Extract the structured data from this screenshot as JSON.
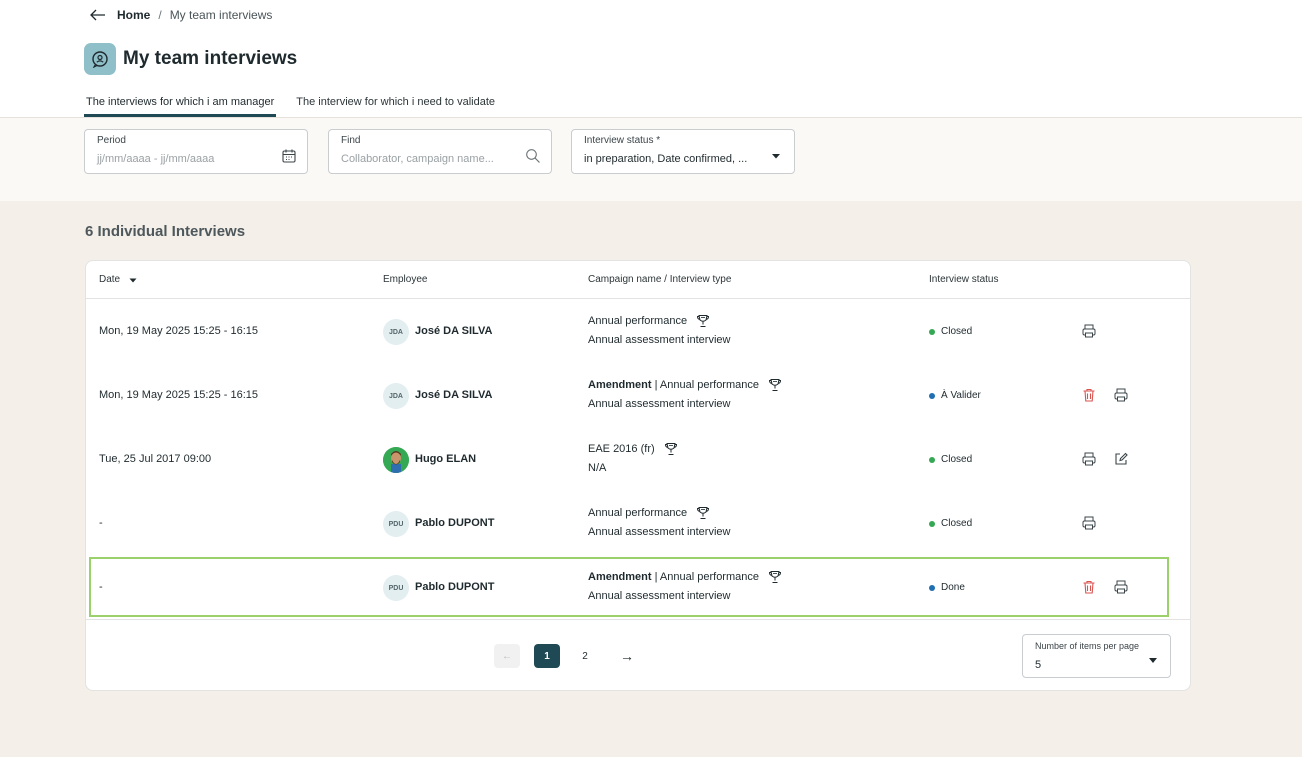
{
  "breadcrumb": {
    "home": "Home",
    "separator": "/",
    "current": "My team interviews",
    "back_icon": "arrow-left-icon"
  },
  "page": {
    "title": "My team interviews",
    "title_icon": "interview-chat-icon"
  },
  "tabs": [
    {
      "label": "The interviews for which i am manager",
      "active": true
    },
    {
      "label": "The interview for which i need to validate",
      "active": false
    }
  ],
  "filters": {
    "period": {
      "label": "Period",
      "placeholder": "jj/mm/aaaa - jj/mm/aaaa",
      "icon": "calendar-icon"
    },
    "find": {
      "label": "Find",
      "placeholder": "Collaborator, campaign name...",
      "icon": "search-icon"
    },
    "status": {
      "label": "Interview status *",
      "value": "in preparation, Date confirmed, ..."
    }
  },
  "summary": {
    "count_label": "6 Individual Interviews"
  },
  "table": {
    "columns": {
      "date": "Date",
      "employee": "Employee",
      "campaign": "Campaign name / Interview type",
      "status": "Interview status"
    },
    "rows": [
      {
        "date": "Mon, 19 May 2025 15:25 - 16:15",
        "initials": "JDA",
        "employee": "José DA SILVA",
        "prefix": "",
        "campaign": "Annual performance",
        "type": "Annual assessment interview",
        "status": "Closed",
        "status_color": "#34a853",
        "actions": [
          "print"
        ]
      },
      {
        "date": "Mon, 19 May 2025 15:25 - 16:15",
        "initials": "JDA",
        "employee": "José DA SILVA",
        "prefix": "Amendment",
        "campaign": " | Annual performance",
        "type": "Annual assessment interview",
        "status": "À Valider",
        "status_color": "#1f6fb2",
        "actions": [
          "delete",
          "print"
        ]
      },
      {
        "date": "Tue, 25 Jul 2017 09:00",
        "initials": "",
        "employee": "Hugo ELAN",
        "prefix": "",
        "campaign": "EAE 2016 (fr)",
        "type": "N/A",
        "status": "Closed",
        "status_color": "#34a853",
        "actions": [
          "print",
          "edit"
        ]
      },
      {
        "date": "-",
        "initials": "PDU",
        "employee": "Pablo DUPONT",
        "prefix": "",
        "campaign": "Annual performance",
        "type": "Annual assessment interview",
        "status": "Closed",
        "status_color": "#34a853",
        "actions": [
          "print"
        ]
      },
      {
        "date": "-",
        "initials": "PDU",
        "employee": "Pablo DUPONT",
        "prefix": "Amendment",
        "campaign": " | Annual performance",
        "type": "Annual assessment interview",
        "status": "Done",
        "status_color": "#1f6fb2",
        "actions": [
          "delete",
          "print"
        ]
      }
    ]
  },
  "pagination": {
    "prev": "←",
    "pages": [
      "1",
      "2"
    ],
    "current": "1",
    "next": "→"
  },
  "items_per_page": {
    "label": "Number of items per page",
    "value": "5"
  },
  "colors": {
    "accent": "#1f4a55",
    "closed": "#34a853",
    "pending": "#1f6fb2",
    "delete": "#d9534f",
    "highlight": "#9bd16a"
  }
}
